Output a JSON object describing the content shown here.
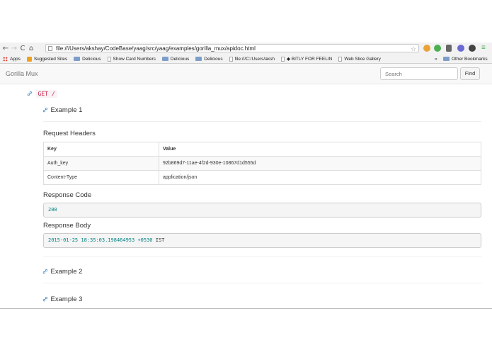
{
  "browser": {
    "url": "file:///Users/akshay/CodeBase/yaag/src/yaag/examples/gorilla_mux/apidoc.html",
    "bookmarks": [
      {
        "label": "Apps",
        "icon": "apps-grid-icon"
      },
      {
        "label": "Suggested Sites",
        "icon": "suggested-sites-icon"
      },
      {
        "label": "Delicious",
        "icon": "folder-icon"
      },
      {
        "label": "Show Card Numbers",
        "icon": "page-icon"
      },
      {
        "label": "Delicious",
        "icon": "folder-icon"
      },
      {
        "label": "Delicious",
        "icon": "folder-icon"
      },
      {
        "label": "file:///C:/Users/aksh",
        "icon": "page-icon"
      },
      {
        "label": "◆ BITLY FOR FEELIN",
        "icon": "page-icon"
      },
      {
        "label": "Web Slice Gallery",
        "icon": "page-icon"
      }
    ],
    "other_bookmarks": "Other Bookmarks",
    "overflow": "»"
  },
  "navbar": {
    "brand": "Gorilla Mux",
    "search_placeholder": "Search",
    "find_label": "Find"
  },
  "endpoint": {
    "method_path": "GET /"
  },
  "examples": [
    {
      "title": "Example 1"
    },
    {
      "title": "Example 2"
    },
    {
      "title": "Example 3"
    }
  ],
  "example1": {
    "request_headers_title": "Request Headers",
    "table": {
      "headers": [
        "Key",
        "Value"
      ],
      "rows": [
        [
          "Auth_key",
          "92b869d7-11ae-4f2d-930e-10867d1d555d"
        ],
        [
          "Content-Type",
          "application/json"
        ]
      ]
    },
    "response_code_title": "Response Code",
    "response_code": "200",
    "response_body_title": "Response Body",
    "response_body": {
      "date": "2015-01-25",
      "time": "18:35:03.198464953",
      "offset": "+0530",
      "zone": "IST"
    }
  },
  "colors": {
    "link": "#337ab7",
    "code_red": "#c7254e",
    "number_teal": "#008080"
  }
}
